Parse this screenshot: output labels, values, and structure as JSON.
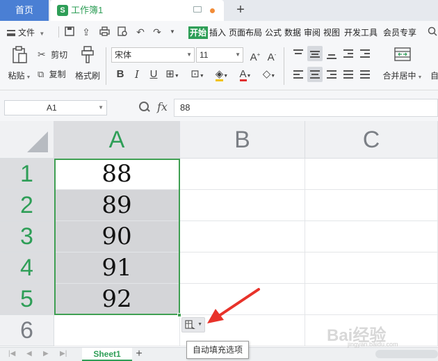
{
  "tabs": {
    "home": "首页",
    "workbook": "工作簿1",
    "workbook_logo": "S",
    "add": "+"
  },
  "menu": {
    "file": "文件",
    "tabs": [
      "开始",
      "插入",
      "页面布局",
      "公式",
      "数据",
      "审阅",
      "视图",
      "开发工具",
      "会员专享"
    ]
  },
  "ribbon": {
    "paste": "粘贴",
    "cut": "剪切",
    "copy": "复制",
    "format_painter": "格式刷",
    "font_name": "宋体",
    "font_size": "11",
    "merge_center": "合并居中",
    "auto": "自"
  },
  "formula_bar": {
    "name_box": "A1",
    "fx": "fx",
    "content": "88"
  },
  "grid": {
    "columns": [
      "A",
      "B",
      "C"
    ],
    "rows": [
      "1",
      "2",
      "3",
      "4",
      "5",
      "6"
    ],
    "values": [
      "88",
      "89",
      "90",
      "91",
      "92"
    ]
  },
  "autofill": {
    "tooltip": "自动填充选项"
  },
  "sheets": {
    "active": "Sheet1",
    "add": "+"
  },
  "watermark": {
    "brand": "Bai经验",
    "url": "jingyan.baidu.com"
  },
  "colors": {
    "accent_green": "#2e9e57",
    "home_tab": "#4a7fd4",
    "selection": "#3f9f52",
    "arrow_red": "#e8322a"
  }
}
